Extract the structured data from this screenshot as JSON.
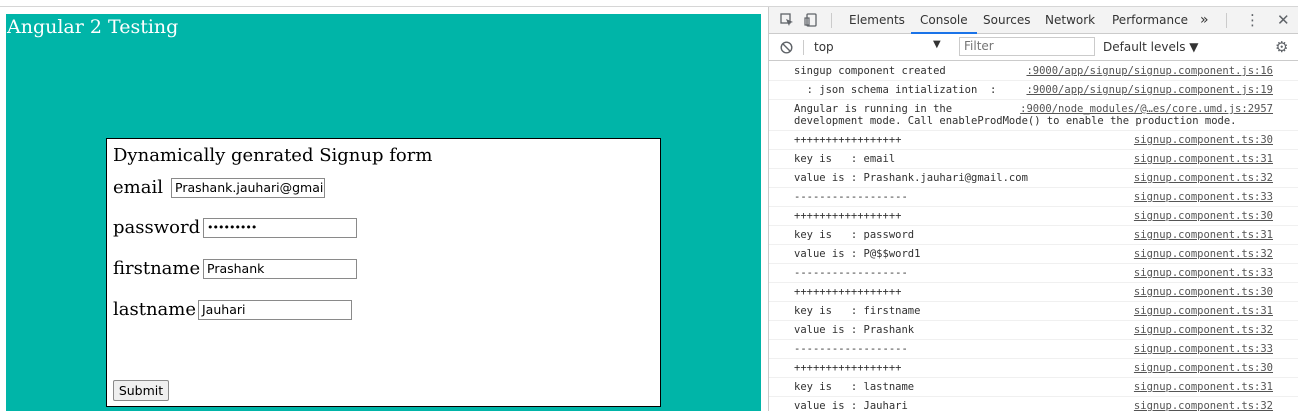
{
  "app": {
    "title": "Angular 2 Testing",
    "form": {
      "title": "Dynamically genrated Signup form",
      "fields": [
        {
          "label": "email",
          "value": "Prashank.jauhari@gmail.com"
        },
        {
          "label": "password",
          "value": "•••••••••"
        },
        {
          "label": "firstname",
          "value": "Prashank"
        },
        {
          "label": "lastname",
          "value": "Jauhari"
        }
      ],
      "submit_label": "Submit"
    }
  },
  "devtools": {
    "tabs": [
      "Elements",
      "Console",
      "Sources",
      "Network",
      "Performance"
    ],
    "active_tab": "Console",
    "more_tabs": "»",
    "context": "top",
    "filter_placeholder": "Filter",
    "levels_label": "Default levels ▼",
    "logs": [
      {
        "msg": "singup component created",
        "src": ":9000/app/signup/signup.component.js:16"
      },
      {
        "msg": "  : json schema intialization  :",
        "src": ":9000/app/signup/signup.component.js:19"
      },
      {
        "msg": "Angular is running in the\ndevelopment mode. Call enableProdMode() to enable the production mode.",
        "src": ":9000/node_modules/@…es/core.umd.js:2957"
      },
      {
        "msg": "+++++++++++++++++",
        "src": "signup.component.ts:30"
      },
      {
        "msg": "key is   : email",
        "src": "signup.component.ts:31"
      },
      {
        "msg": "value is : Prashank.jauhari@gmail.com",
        "src": "signup.component.ts:32"
      },
      {
        "msg": "------------------",
        "src": "signup.component.ts:33"
      },
      {
        "msg": "+++++++++++++++++",
        "src": "signup.component.ts:30"
      },
      {
        "msg": "key is   : password",
        "src": "signup.component.ts:31"
      },
      {
        "msg": "value is : P@$$word1",
        "src": "signup.component.ts:32"
      },
      {
        "msg": "------------------",
        "src": "signup.component.ts:33"
      },
      {
        "msg": "+++++++++++++++++",
        "src": "signup.component.ts:30"
      },
      {
        "msg": "key is   : firstname",
        "src": "signup.component.ts:31"
      },
      {
        "msg": "value is : Prashank",
        "src": "signup.component.ts:32"
      },
      {
        "msg": "------------------",
        "src": "signup.component.ts:33"
      },
      {
        "msg": "+++++++++++++++++",
        "src": "signup.component.ts:30"
      },
      {
        "msg": "key is   : lastname",
        "src": "signup.component.ts:31"
      },
      {
        "msg": "value is : Jauhari",
        "src": "signup.component.ts:32"
      }
    ],
    "icons": [
      "inspect-icon",
      "device-icon",
      "more-icon",
      "close-icon",
      "clear-console-icon",
      "settings-icon"
    ]
  },
  "colors": {
    "page_background": "#00b5a8",
    "active_tab_underline": "#1a73e8"
  }
}
